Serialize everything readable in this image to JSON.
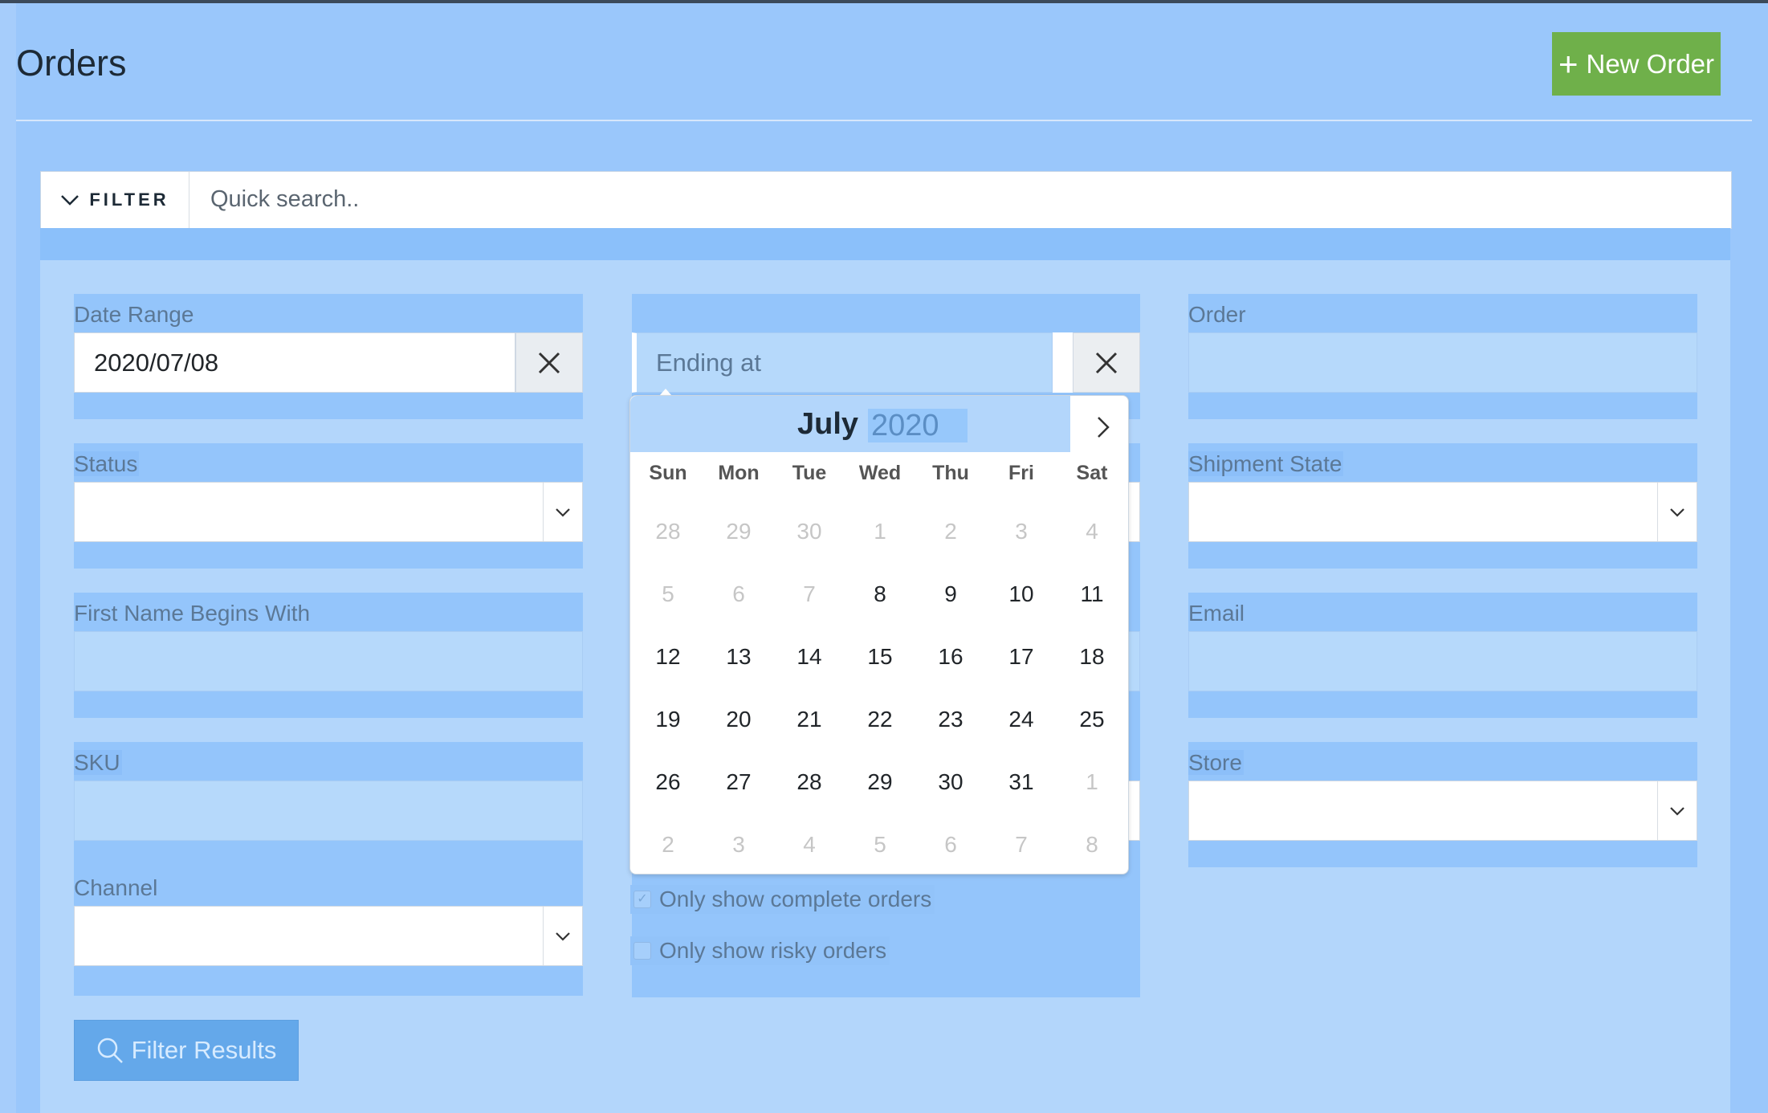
{
  "page": {
    "title": "Orders",
    "new_order_label": "New Order"
  },
  "filter": {
    "toggle_label": "FILTER",
    "search_placeholder": "Quick search.."
  },
  "form": {
    "date_range": {
      "label": "Date Range",
      "start_value": "2020/07/08",
      "end_placeholder": "Ending at"
    },
    "order": {
      "label": "Order"
    },
    "status": {
      "label": "Status"
    },
    "shipment_state": {
      "label": "Shipment State"
    },
    "first_name": {
      "label": "First Name Begins With"
    },
    "email": {
      "label": "Email"
    },
    "sku": {
      "label": "SKU"
    },
    "store": {
      "label": "Store"
    },
    "channel": {
      "label": "Channel"
    },
    "complete_only": {
      "label": "Only show complete orders"
    },
    "risky_only": {
      "label": "Only show risky orders"
    },
    "submit_label": "Filter Results"
  },
  "calendar": {
    "month": "July",
    "year": "2020",
    "weekdays": [
      "Sun",
      "Mon",
      "Tue",
      "Wed",
      "Thu",
      "Fri",
      "Sat"
    ],
    "days": [
      {
        "d": "28",
        "out": true
      },
      {
        "d": "29",
        "out": true
      },
      {
        "d": "30",
        "out": true
      },
      {
        "d": "1",
        "out": true
      },
      {
        "d": "2",
        "out": true
      },
      {
        "d": "3",
        "out": true
      },
      {
        "d": "4",
        "out": true
      },
      {
        "d": "5",
        "out": true
      },
      {
        "d": "6",
        "out": true
      },
      {
        "d": "7",
        "out": true
      },
      {
        "d": "8",
        "out": false
      },
      {
        "d": "9",
        "out": false
      },
      {
        "d": "10",
        "out": false
      },
      {
        "d": "11",
        "out": false
      },
      {
        "d": "12",
        "out": false
      },
      {
        "d": "13",
        "out": false
      },
      {
        "d": "14",
        "out": false
      },
      {
        "d": "15",
        "out": false
      },
      {
        "d": "16",
        "out": false
      },
      {
        "d": "17",
        "out": false
      },
      {
        "d": "18",
        "out": false
      },
      {
        "d": "19",
        "out": false
      },
      {
        "d": "20",
        "out": false
      },
      {
        "d": "21",
        "out": false
      },
      {
        "d": "22",
        "out": false
      },
      {
        "d": "23",
        "out": false
      },
      {
        "d": "24",
        "out": false
      },
      {
        "d": "25",
        "out": false
      },
      {
        "d": "26",
        "out": false
      },
      {
        "d": "27",
        "out": false
      },
      {
        "d": "28",
        "out": false
      },
      {
        "d": "29",
        "out": false
      },
      {
        "d": "30",
        "out": false
      },
      {
        "d": "31",
        "out": false
      },
      {
        "d": "1",
        "out": true
      },
      {
        "d": "2",
        "out": true
      },
      {
        "d": "3",
        "out": true
      },
      {
        "d": "4",
        "out": true
      },
      {
        "d": "5",
        "out": true
      },
      {
        "d": "6",
        "out": true
      },
      {
        "d": "7",
        "out": true
      },
      {
        "d": "8",
        "out": true
      }
    ]
  },
  "icons": {
    "new_order": "plus-icon",
    "toggle": "chevron-down-icon",
    "clear": "close-icon",
    "select": "chevron-down-icon",
    "next": "chevron-right-icon",
    "submit": "search-icon"
  },
  "colors": {
    "primary_bg": "#9ac7fb",
    "success": "#6fb04a",
    "panel": "#b3d6fb"
  }
}
